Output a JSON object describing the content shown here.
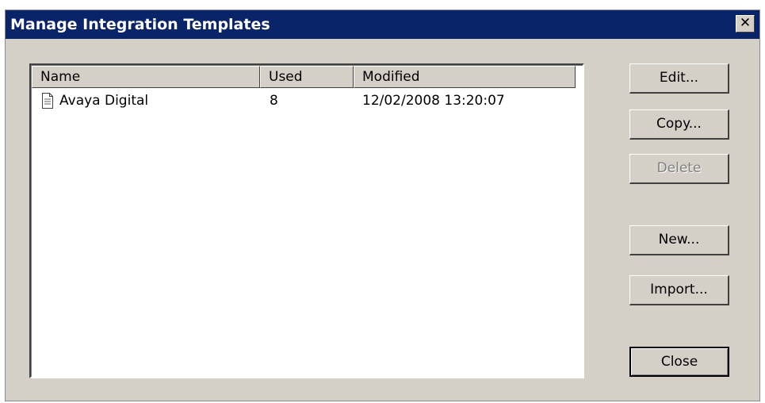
{
  "window": {
    "title": "Manage Integration Templates",
    "close_glyph": "✕"
  },
  "list": {
    "columns": [
      "Name",
      "Used",
      "Modified"
    ],
    "rows": [
      {
        "icon": "document-icon",
        "name": "Avaya Digital",
        "used": "8",
        "modified": "12/02/2008 13:20:07"
      }
    ]
  },
  "buttons": {
    "edit": "Edit...",
    "copy": "Copy...",
    "delete": "Delete",
    "new": "New...",
    "import": "Import...",
    "close": "Close"
  },
  "colors": {
    "titlebar": "#0a246a",
    "dialog_face": "#d4d0c8",
    "disabled_text": "#808080"
  }
}
